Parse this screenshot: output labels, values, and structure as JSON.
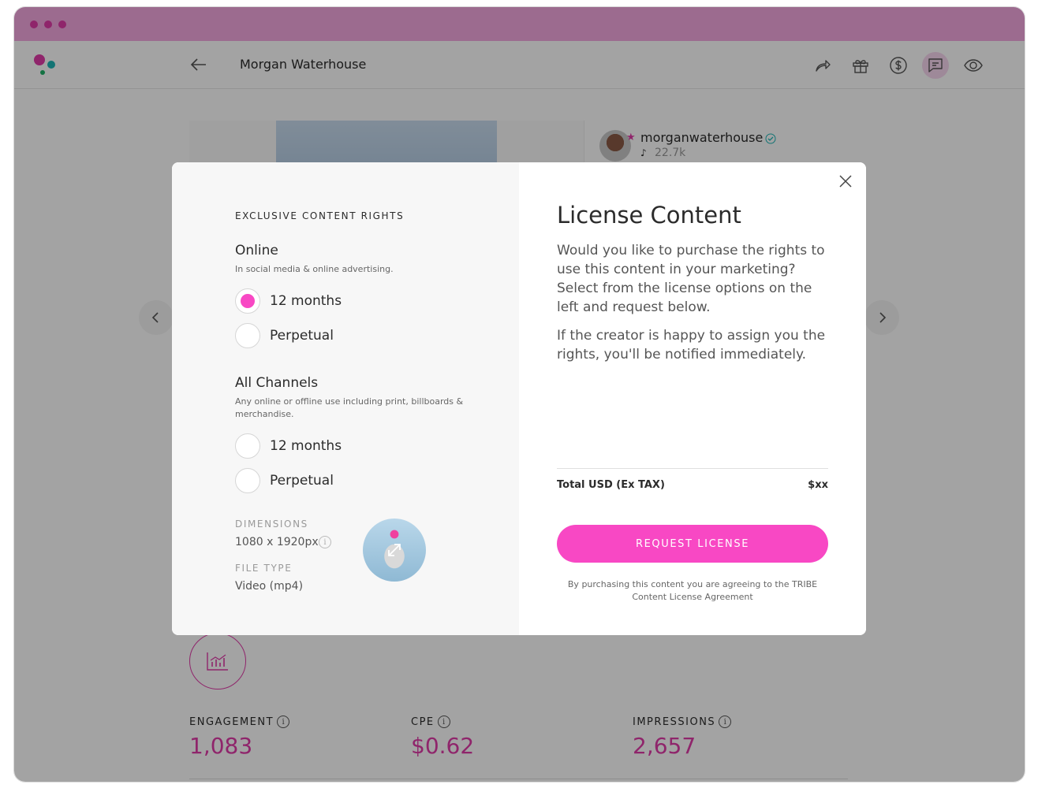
{
  "app": {
    "page_title": "Morgan Waterhouse",
    "accent_color": "#e03aa8",
    "toolbar_icons": [
      "share-icon",
      "gift-icon",
      "dollar-icon",
      "message-icon",
      "eye-icon"
    ],
    "active_toolbar_icon": "message-icon"
  },
  "profile": {
    "username": "morganwaterhouse",
    "followers": "22.7k"
  },
  "stats": [
    {
      "label": "ENGAGEMENT",
      "value": "1,083"
    },
    {
      "label": "CPE",
      "value": "$0.62"
    },
    {
      "label": "IMPRESSIONS",
      "value": "2,657"
    }
  ],
  "modal": {
    "left": {
      "section_title": "EXCLUSIVE CONTENT RIGHTS",
      "groups": [
        {
          "title": "Online",
          "description": "In social media & online advertising.",
          "options": [
            {
              "label": "12 months",
              "selected": true
            },
            {
              "label": "Perpetual",
              "selected": false
            }
          ]
        },
        {
          "title": "All Channels",
          "description": "Any online or offline use including print, billboards & merchandise.",
          "options": [
            {
              "label": "12 months",
              "selected": false
            },
            {
              "label": "Perpetual",
              "selected": false
            }
          ]
        }
      ],
      "dimensions_label": "DIMENSIONS",
      "dimensions_value": "1080 x 1920px",
      "file_type_label": "FILE TYPE",
      "file_type_value": "Video (mp4)"
    },
    "right": {
      "title": "License Content",
      "paragraph1": "Would you like to purchase the rights to use this content in your marketing? Select from the license options on the left and request below.",
      "paragraph2": "If the creator is happy to assign you the rights, you'll be notified immediately.",
      "total_label": "Total USD (Ex TAX)",
      "total_value": "$xx",
      "button_label": "REQUEST LICENSE",
      "legal_text": "By purchasing this content you are agreeing to the TRIBE Content License Agreement"
    }
  }
}
